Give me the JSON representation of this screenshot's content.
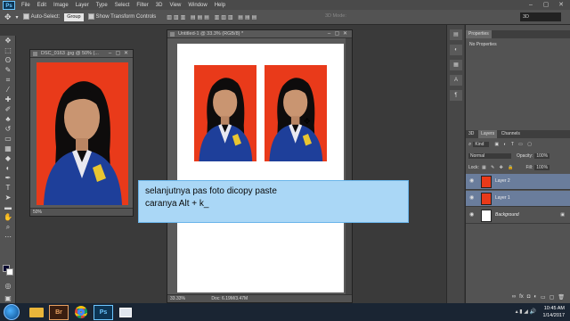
{
  "menubar": {
    "logo": "Ps",
    "items": [
      "File",
      "Edit",
      "Image",
      "Layer",
      "Type",
      "Select",
      "Filter",
      "3D",
      "View",
      "Window",
      "Help"
    ],
    "window_controls": [
      "–",
      "▢",
      "✕"
    ]
  },
  "optionsbar": {
    "auto_select_label": "Auto-Select:",
    "auto_select_value": "Group",
    "show_transform_label": "Show Transform Controls",
    "mode_3d_label": "3D Mode:",
    "workspace": "3D"
  },
  "doc_small": {
    "title": "DSC_0163 .jpg @ 50% (...",
    "zoom": "50%"
  },
  "doc_main": {
    "title": "Untitled-1 @ 33.3% (RGB/8) *",
    "zoom": "33.33%",
    "doc_size": "Doc: 6.19M/3.47M"
  },
  "caption": {
    "line1": "selanjutnya pas foto dicopy paste",
    "line2": "caranya Alt + k_"
  },
  "properties_panel": {
    "tab": "Properties",
    "message": "No Properties"
  },
  "layers_panel": {
    "tabs": [
      "3D",
      "Layers",
      "Channels"
    ],
    "filter_label": "Kind",
    "blend_mode": "Normal",
    "opacity_label": "Opacity:",
    "opacity_value": "100%",
    "lock_label": "Lock:",
    "fill_label": "Fill:",
    "fill_value": "100%",
    "layers": [
      {
        "name": "Layer 2",
        "selected": true
      },
      {
        "name": "Layer 1",
        "selected": true
      },
      {
        "name": "Background",
        "selected": false
      }
    ]
  },
  "taskbar": {
    "apps": [
      "explorer",
      "bridge",
      "chrome",
      "photoshop",
      "window"
    ],
    "bridge_label": "Br",
    "ps_label": "Ps",
    "time": "10:45 AM",
    "date": "1/14/2017"
  },
  "colors": {
    "photo_background": "#e93a1a",
    "caption_background": "#aad7f6",
    "layer_selected": "#6a7d9c"
  }
}
